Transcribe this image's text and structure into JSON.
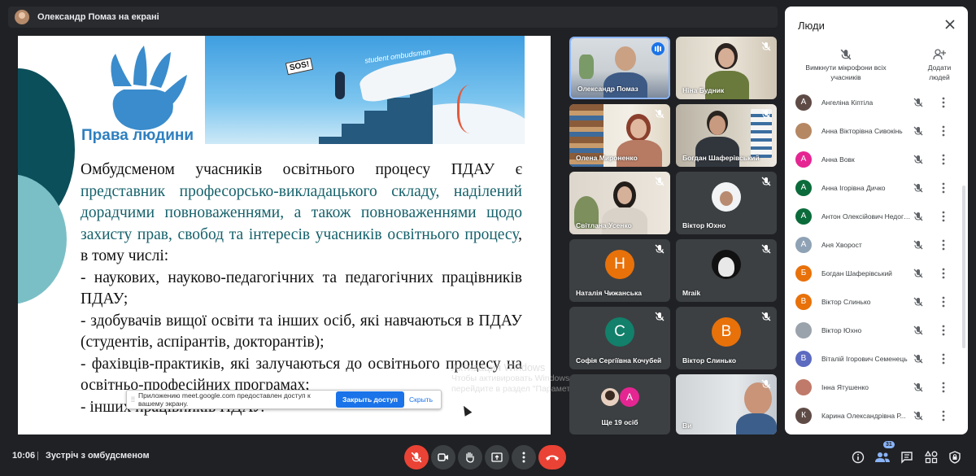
{
  "presenter": {
    "label": "Олександр Помаз на екрані"
  },
  "slide": {
    "logo_text": "Права людини",
    "banner_sos": "SOS!",
    "banner_student": "student ombudsman",
    "para1_a": "Омбудсменом учасників освітнього процесу ПДАУ є ",
    "para1_b": "представник професорсько-викладацького складу, наділений дорадчими повноваженнями, а також повноваженнями щодо захисту прав, свобод та інтересів учасників освітнього процесу",
    "para1_c": ", в тому числі:",
    "item1": "- наукових, науково-педагогічних та педагогічних працівників ПДАУ;",
    "item2": "- здобувачів вищої освіти та інших осіб, які навчаються в ПДАУ (студентів, аспірантів, докторантів);",
    "item3": "- фахівців-практиків, які залучаються до освітнього процесу на освітньо-професійних програмах;",
    "item4": "- інших працівників ПДАУ."
  },
  "notification": {
    "text": "Приложению meet.google.com предоставлен доступ к вашему экрану.",
    "button": "Закрыть доступ",
    "hide": "Скрыть"
  },
  "watermark": {
    "line1": "Активация Windows",
    "line2": "Чтобы активировать Windows,",
    "line3": "перейдите в раздел \"Параметры\"."
  },
  "tiles": [
    {
      "name": "Олександр Помаз"
    },
    {
      "name": "Ніна Будник"
    },
    {
      "name": "Олена Мироненко"
    },
    {
      "name": "Богдан Шаферівський"
    },
    {
      "name": "Світлана Усенко"
    },
    {
      "name": "Віктор Юхно"
    },
    {
      "name": "Наталія Чижанська",
      "letter": "Н",
      "color": "#e8710a"
    },
    {
      "name": "Mraik"
    },
    {
      "name": "Софія Сергіївна Кочубей",
      "letter": "С",
      "color": "#12806a"
    },
    {
      "name": "Віктор Слинько",
      "letter": "В",
      "color": "#e8710a"
    },
    {
      "name": "Ще 19 осіб",
      "letter": "А",
      "color": "#e52592"
    },
    {
      "name": "Ви"
    }
  ],
  "panel": {
    "title": "Люди",
    "mute_all": "Вимкнути мікрофони всіх учасників",
    "add_people": "Додати людей",
    "people": [
      {
        "name": "Ангеліна Кіптіла",
        "letter": "А",
        "color": "#5f4b46"
      },
      {
        "name": "Анна Вікторівна Сивокінь",
        "letter": "",
        "color": "#b58863"
      },
      {
        "name": "Анна Вовк",
        "letter": "А",
        "color": "#e52592"
      },
      {
        "name": "Анна Ігорівна Дичко",
        "letter": "А",
        "color": "#0b6b3a"
      },
      {
        "name": "Антон Олексійович Недогон",
        "letter": "А",
        "color": "#0b6b3a"
      },
      {
        "name": "Аня Хворост",
        "letter": "А",
        "color": "#8fa2b5"
      },
      {
        "name": "Богдан Шаферівський",
        "letter": "Б",
        "color": "#e8710a"
      },
      {
        "name": "Віктор Слинько",
        "letter": "В",
        "color": "#e8710a"
      },
      {
        "name": "Віктор Юхно",
        "letter": "",
        "color": "#9aa3ab"
      },
      {
        "name": "Віталій Ігорович Семенець",
        "letter": "В",
        "color": "#5c6bc0"
      },
      {
        "name": "Інна Ятушенко",
        "letter": "",
        "color": "#c07a6a"
      },
      {
        "name": "Карина Олександрівна Р...",
        "letter": "К",
        "color": "#5f4b46"
      }
    ]
  },
  "bottom": {
    "time": "10:06",
    "separator": "|",
    "meeting": "Зустріч з омбудсменом",
    "people_count": "31"
  }
}
